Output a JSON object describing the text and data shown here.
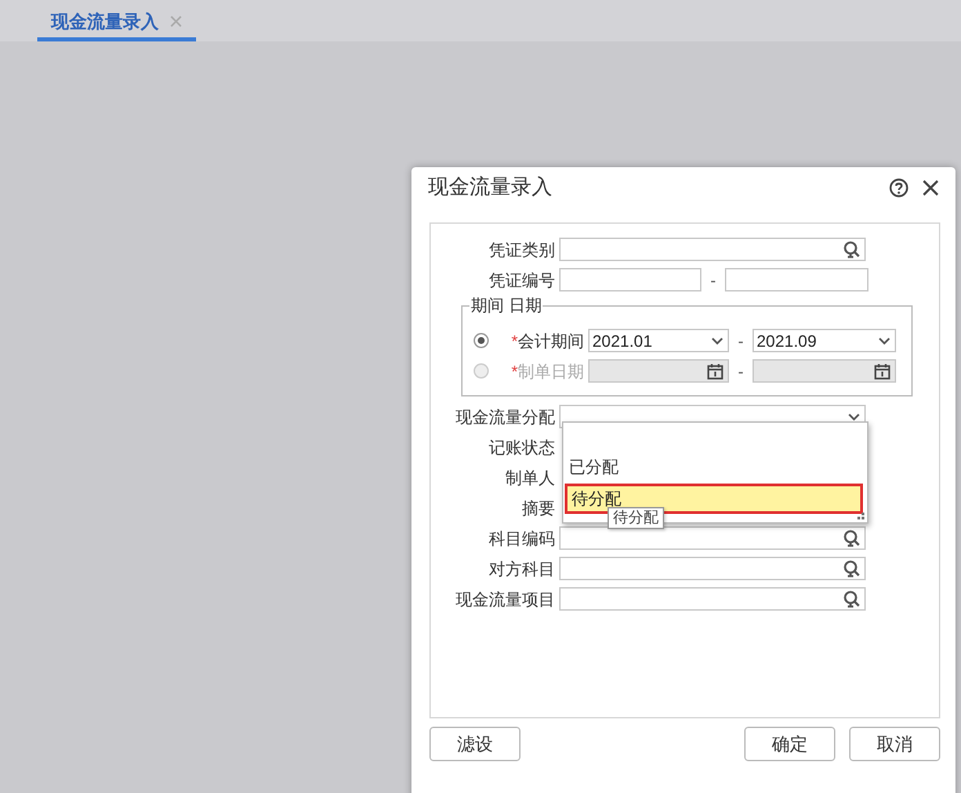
{
  "tab": {
    "label": "现金流量录入",
    "selected": true
  },
  "dialog": {
    "title": "现金流量录入",
    "top_fields": [
      {
        "label": "凭证类别",
        "kind": "lookup"
      },
      {
        "label": "凭证编号",
        "kind": "range",
        "separator": "-"
      }
    ],
    "period_group": {
      "legend": "期间 日期",
      "options": [
        {
          "required_mark": "*",
          "label": "会计期间",
          "selected": true,
          "disabled": false,
          "kind": "select",
          "from": "2021.01",
          "separator": "-",
          "to": "2021.09"
        },
        {
          "required_mark": "*",
          "label": "制单日期",
          "selected": false,
          "disabled": true,
          "kind": "date",
          "separator": "-"
        }
      ]
    },
    "fields": [
      {
        "label": "现金流量分配",
        "kind": "select"
      },
      {
        "label": "记账状态",
        "kind": "covered"
      },
      {
        "label": "制单人",
        "kind": "covered"
      },
      {
        "label": "摘要",
        "kind": "covered"
      },
      {
        "label": "科目编码",
        "kind": "lookup"
      },
      {
        "label": "对方科目",
        "kind": "lookup"
      },
      {
        "label": "现金流量项目",
        "kind": "lookup"
      }
    ],
    "dropdown": {
      "options": [
        {
          "label": "已分配",
          "selected": false
        },
        {
          "label": "待分配",
          "selected": true
        }
      ],
      "tooltip": "待分配"
    },
    "left_buttons": [
      {
        "label": "滤设"
      }
    ],
    "right_buttons": [
      {
        "label": "确定"
      },
      {
        "label": "取消"
      }
    ]
  }
}
